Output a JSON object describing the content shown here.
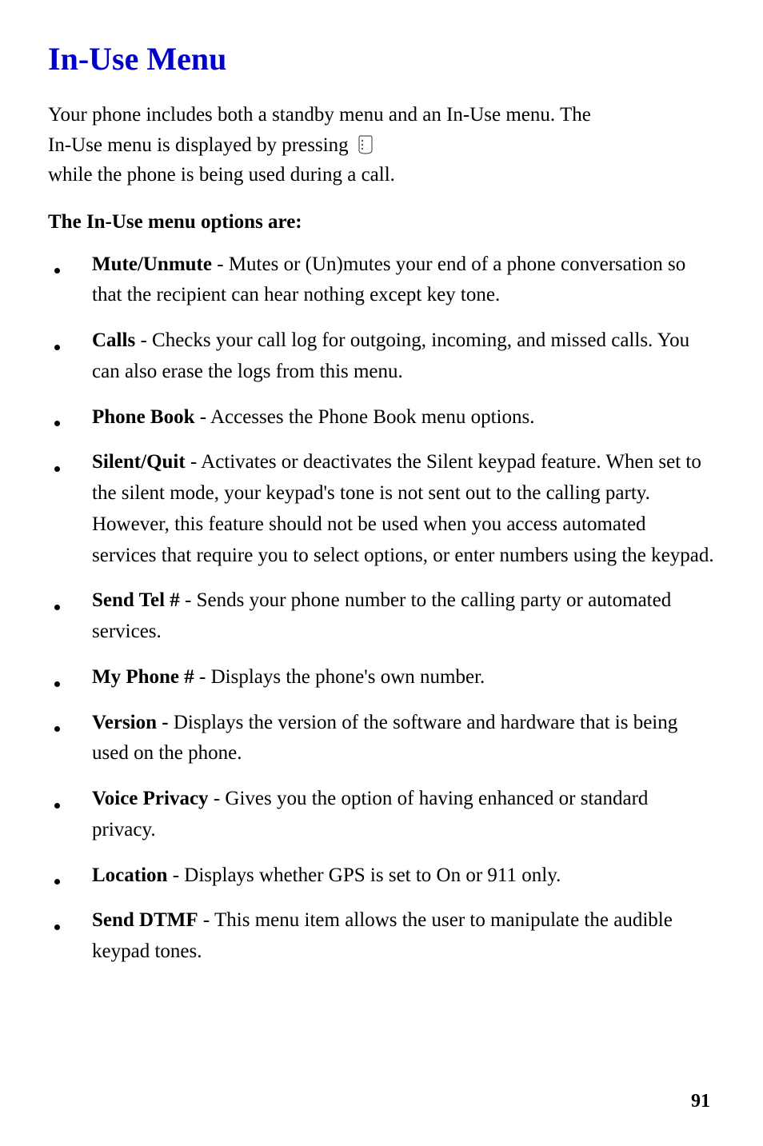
{
  "title": "In-Use Menu",
  "intro": {
    "line1": "Your phone includes both a standby menu and an In-Use menu. The",
    "pre_icon": "In-Use menu is displayed by pressing",
    "post_icon": " while the phone is being used during a call."
  },
  "subheading": "The In-Use menu options are:",
  "items": [
    {
      "label": "Mute/Unmute",
      "sep": " - ",
      "desc": "Mutes or (Un)mutes your end of a phone conversation so that the recipient can hear nothing except key tone."
    },
    {
      "label": "Calls",
      "sep": " - ",
      "desc": "Checks your call log for outgoing, incoming, and missed calls. You can also erase the logs from this menu."
    },
    {
      "label": "Phone Book",
      "sep": " - ",
      "desc": "Accesses the Phone Book menu options."
    },
    {
      "label": "Silent/Quit",
      "sep": " - ",
      "desc": "Activates or deactivates the Silent keypad feature. When set to the silent mode, your keypad's tone is not sent out to the calling party. However, this feature should not be used when you access automated services that require you to select options, or enter numbers using the keypad."
    },
    {
      "label": "Send Tel #",
      "sep": " - ",
      "desc": "Sends your phone number to the calling party or automated services."
    },
    {
      "label": "My Phone #",
      "sep": " - ",
      "desc": "Displays the phone's own number."
    },
    {
      "label": "Version -",
      "sep": " ",
      "desc": "Displays the version of the software and hardware that is being used on the phone."
    },
    {
      "label": "Voice Privacy",
      "sep": " - ",
      "desc": "Gives you the option of having enhanced or standard privacy."
    },
    {
      "label": "Location",
      "sep": " - ",
      "desc": "Displays whether GPS is set to On or 911 only."
    },
    {
      "label": "Send DTMF",
      "sep": " - ",
      "desc": "This menu item allows the user to manipulate the audible keypad tones."
    }
  ],
  "page_number": "91"
}
